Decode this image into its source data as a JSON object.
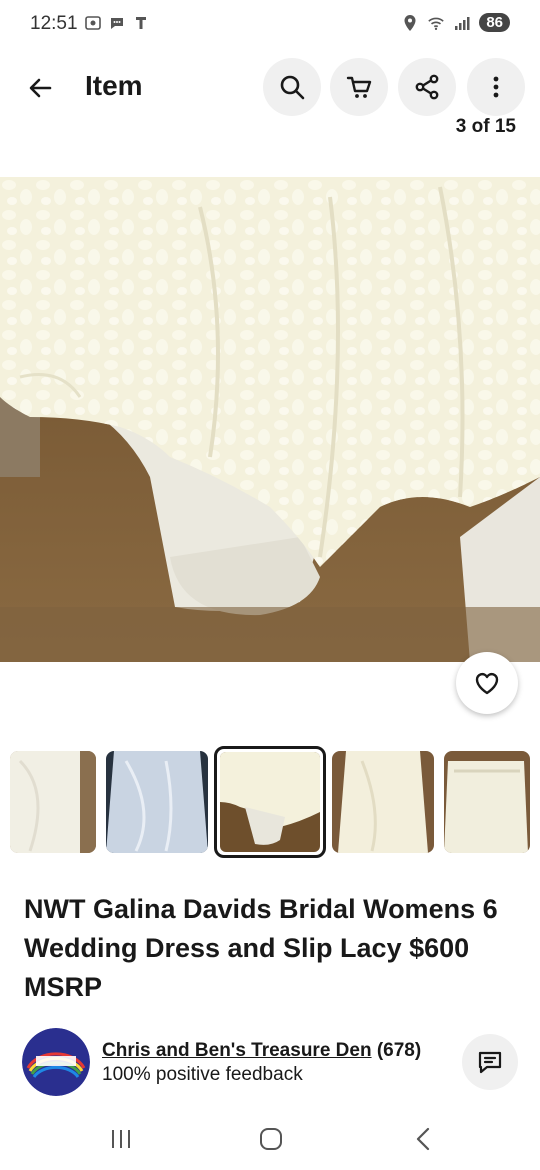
{
  "status_bar": {
    "time": "12:51",
    "battery": "86",
    "icons_left": [
      "screenshot-icon",
      "chat-bubble-icon",
      "tmobile-play-icon"
    ],
    "icons_right": [
      "location-icon",
      "wifi-icon",
      "signal-icon"
    ]
  },
  "header": {
    "back_icon": "arrow-left-icon",
    "title": "Item",
    "actions": [
      "search-icon",
      "cart-icon",
      "share-icon",
      "more-vertical-icon"
    ]
  },
  "gallery": {
    "counter": "3 of 15",
    "thumbnails": [
      {
        "description_icon": "dress-thumbnail-1"
      },
      {
        "description_icon": "dress-thumbnail-2"
      },
      {
        "description_icon": "dress-thumbnail-3",
        "selected": true
      },
      {
        "description_icon": "dress-thumbnail-4"
      },
      {
        "description_icon": "dress-thumbnail-5"
      }
    ]
  },
  "item": {
    "title": "NWT Galina Davids Bridal Womens 6 Wedding Dress and Slip Lacy $600 MSRP"
  },
  "seller": {
    "name": "Chris and Ben's Treasure Den",
    "feedback_count": "(678)",
    "positive_feedback": "100% positive feedback",
    "avatar_text": "CHRIS AND BEN'S TREASURE DEN"
  },
  "nav": {
    "icons": [
      "recent-apps-icon",
      "home-icon",
      "back-icon"
    ]
  },
  "colors": {
    "accent": "#191919",
    "button_bg": "#f0f0f0",
    "avatar_bg": "#2a2f8f"
  }
}
